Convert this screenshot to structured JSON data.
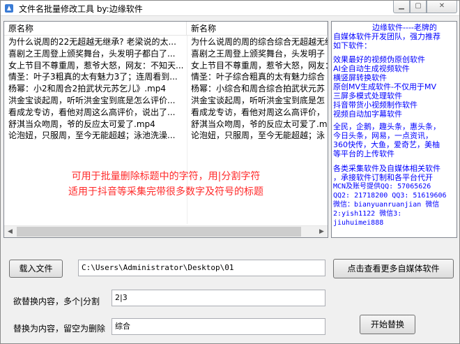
{
  "window": {
    "title": "文件名批量修改工具 by:边缘软件"
  },
  "list": {
    "columns": [
      "原名称",
      "新名称"
    ],
    "rows": [
      [
        "为什么说周的22无超越无继承? 老梁说的太...",
        "为什么说周的周的综合综合无超越无继承"
      ],
      [
        "喜剧之王周登上颁奖舞台，头发明子都白了...",
        "喜剧之王周登上颁奖舞台，头发明子"
      ],
      [
        "女上节目不尊重周，惹爷大怒，网友：不知天...",
        "女上节目不尊重周，惹爷大怒，网友：不知天"
      ],
      [
        "情圣：叶子3粗真的太有魅力3了；连周看到...",
        "情圣：叶子综合粗真的太有魅力综合"
      ],
      [
        "杨幂：小2和周合2拍武状元苏乞儿》.mp4",
        "杨幂：小综合和周合综合拍武状元苏"
      ],
      [
        "洪金宝谈起周，听听洪金宝到底是怎么评价...",
        "洪金宝谈起周，听听洪金宝到底是怎"
      ],
      [
        "看成龙专访，看他对周这么高评价，说出了...",
        "看成龙专访，看他对周这么高评价，"
      ],
      [
        "舒淇当众吻周，爷的反应太可爱了.mp4",
        "舒淇当众吻周，爷的反应太可爱了.mp"
      ],
      [
        "论泡妞，只服周，至今无能超越；泳池洗澡...",
        "论泡妞，只服周，至今无能超越；泳"
      ]
    ],
    "hint_line1": "可用于批量删除标题中的字符，用|分割字符",
    "hint_line2": "适用于抖音等采集完带很多数字及符号的标题"
  },
  "info": {
    "lines": [
      "边缘软件----老牌的",
      "自媒体软件开发团队，强力推荐",
      "如下软件：",
      "",
      "效果最好的视频伪原创软件",
      "AI全自动生成视频软件",
      "横竖屏转换软件",
      "原创MV生成软件-不仅用于MV",
      "三屏多模式处理软件",
      "抖音带货小视频制作软件",
      "视频自动加字幕软件",
      "",
      "全民，企鹅，趣头条，惠头条，",
      "今日头条，网易，一点资讯，",
      "360快传，大鱼，爱奇艺，美柚",
      "等平台的上传软件",
      "",
      "各类采集软件及自媒体相关软件",
      "，承接软件订制和各平台代开",
      "MCN及账号提供QQ: 57065626",
      "QQ2: 21718200 QQ3: 51619606",
      "微信：bianyuanruanjian  微信",
      "2:yish1122 微信3:",
      "jiuhuimei888"
    ],
    "text_color": "#0000ff"
  },
  "controls": {
    "load_button": "载入文件",
    "path_value": "C:\\Users\\Administrator\\Desktop\\01",
    "more_button": "点击查看更多自媒体软件",
    "find_label": "欲替换内容，多个|分割",
    "find_value": "2|3",
    "replace_label": "替换为内容，留空为删除",
    "replace_value": "综合",
    "start_button": "开始替换"
  },
  "colors": {
    "hint": "#ff2a2a",
    "info_text": "#0000ff",
    "window_bg": "#f0f0f0"
  }
}
